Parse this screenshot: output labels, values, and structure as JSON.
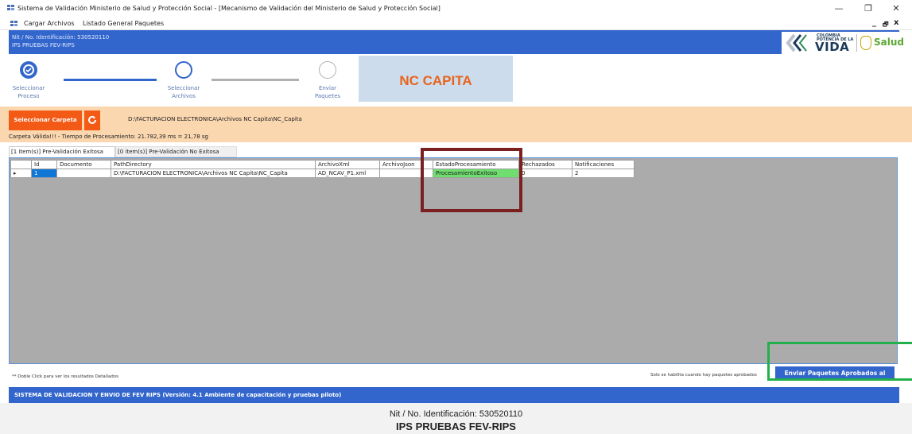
{
  "window": {
    "title": "Sistema de Validación Ministerio de Salud y Protección Social - [Mecanismo de Validación del Ministerio de Salud y Protección Social]",
    "minimize": "—",
    "maximize": "❐",
    "close": "✕"
  },
  "menu": {
    "items": [
      "Cargar Archivos",
      "Listado General Paquetes"
    ],
    "mdi_minimize": "_",
    "mdi_restore": "🗗",
    "mdi_close": "x"
  },
  "header": {
    "id_line": "Nit / No. Identificación: 530520110",
    "name_line": "IPS PRUEBAS FEV-RIPS",
    "logo_small_1": "COLOMBIA",
    "logo_small_2": "POTENCIA DE LA",
    "logo_vida": "VIDA",
    "logo_salud": "Salud"
  },
  "stepper": {
    "steps": [
      {
        "label_1": "Seleccionar",
        "label_2": "Proceso",
        "state": "done"
      },
      {
        "label_1": "Seleccionar",
        "label_2": "Archivos",
        "state": "current"
      },
      {
        "label_1": "Enviar",
        "label_2": "Paquetes",
        "state": "pending"
      }
    ],
    "process_name": "NC CAPITA",
    "colors": {
      "done": "#3366cc",
      "pending": "#b0b0b0",
      "accent": "#e8641c"
    }
  },
  "folder": {
    "select_button": "Seleccionar Carpeta",
    "refresh_icon": "refresh-icon",
    "path": "D:\\FACTURACION ELECTRONICA\\Archivos NC Capita\\NC_Capita",
    "status": "Carpeta Válida!!! - Tiempo de Procesamiento: 21.782,39 ms = 21,78 sg"
  },
  "tabs": [
    {
      "label": "[1 item(s)] Pre-Validación Exitosa",
      "active": true
    },
    {
      "label": "[0 item(s)] Pre-Validación No Exitosa",
      "active": false
    }
  ],
  "grid": {
    "columns": [
      "Id",
      "Documento",
      "PathDirectory",
      "ArchivoXml",
      "ArchivoJson",
      "EstadoProcesamiento",
      "Rechazados",
      "Notificaciones"
    ],
    "rows": [
      {
        "marker": "▸",
        "cells": [
          "1",
          "",
          "D:\\FACTURACION ELECTRONICA\\Archivos NC Capita\\NC_Capita",
          "AD_NCAV_P1.xml",
          "",
          "ProcesamientoExitoso",
          "0",
          "2"
        ]
      }
    ]
  },
  "status_strip": {
    "hint_left": "** Doble Click para ver los resultados Detallados",
    "hint_right": "Solo se habilita cuando hay paquetes aprobados",
    "send_button": "Enviar Paquetes Aprobados al"
  },
  "footer": {
    "system_line": "SISTEMA DE VALIDACION Y ENVIO DE FEV RIPS  (Versión: 4.1 Ambiente de capacitación y pruebas piloto)",
    "id_line": "Nit / No. Identificación: 530520110",
    "name_line": "IPS PRUEBAS FEV-RIPS"
  }
}
